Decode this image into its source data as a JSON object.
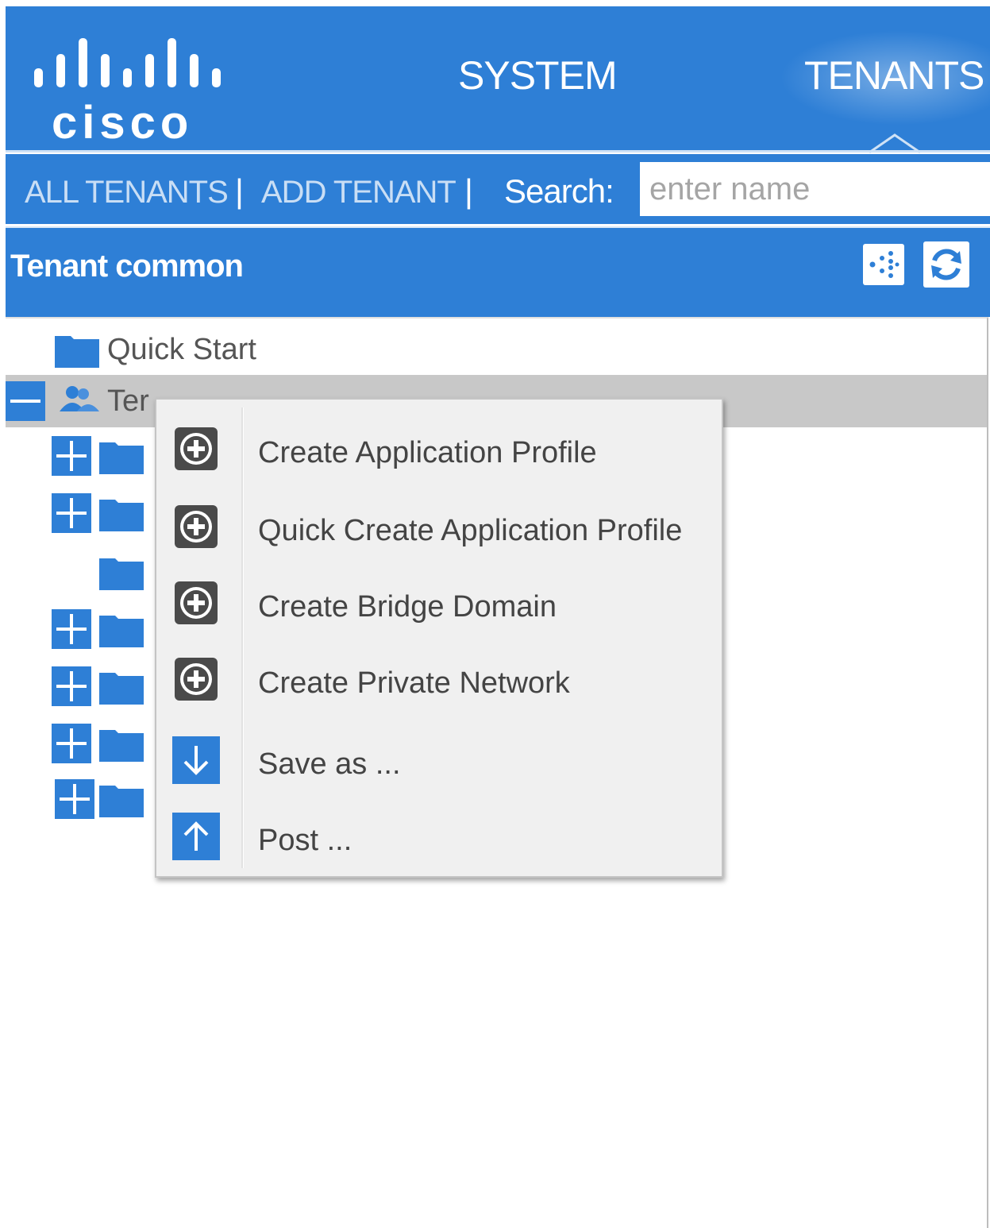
{
  "header": {
    "logo_text": "cisco",
    "nav": [
      {
        "label": "SYSTEM"
      },
      {
        "label": "TENANTS"
      }
    ]
  },
  "subnav": {
    "all_tenants": "ALL TENANTS",
    "add_tenant": "ADD TENANT",
    "separator": "|",
    "search_label": "Search:",
    "search_placeholder": "enter name",
    "search_value": ""
  },
  "panel": {
    "title": "Tenant common"
  },
  "tree": {
    "quick_start": "Quick Start",
    "tenant_label": "Ter"
  },
  "context_menu": {
    "items": [
      {
        "label": "Create Application Profile",
        "icon": "plus-circle-icon"
      },
      {
        "label": "Quick Create Application Profile",
        "icon": "plus-circle-icon"
      },
      {
        "label": "Create Bridge Domain",
        "icon": "plus-circle-icon"
      },
      {
        "label": "Create Private Network",
        "icon": "plus-circle-icon"
      },
      {
        "label": "Save as ...",
        "icon": "download-arrow-icon"
      },
      {
        "label": "Post ...",
        "icon": "upload-arrow-icon"
      }
    ]
  },
  "colors": {
    "brand_blue": "#2e7fd6",
    "selected_row": "#c8c8c8",
    "menu_bg": "#f0f0f0"
  }
}
